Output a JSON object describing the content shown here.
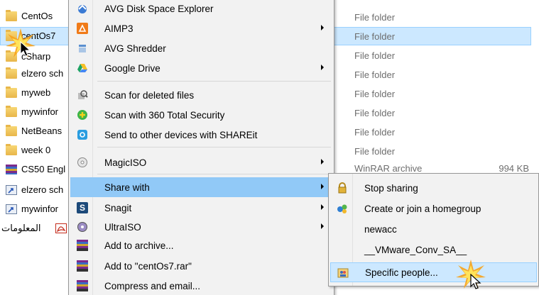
{
  "explorer": {
    "files": [
      {
        "name": "CentOs",
        "type": "File folder",
        "size": "",
        "icon": "folder-icon"
      },
      {
        "name": "centOs7",
        "type": "File folder",
        "size": "",
        "icon": "folder-icon",
        "selected": true
      },
      {
        "name": "cSharp",
        "type": "File folder",
        "size": "",
        "icon": "folder-icon"
      },
      {
        "name": "elzero sch",
        "type": "File folder",
        "size": "",
        "icon": "folder-icon"
      },
      {
        "name": "myweb",
        "type": "File folder",
        "size": "",
        "icon": "folder-icon"
      },
      {
        "name": "mywinfor",
        "type": "File folder",
        "size": "",
        "icon": "folder-icon"
      },
      {
        "name": "NetBeans",
        "type": "File folder",
        "size": "",
        "icon": "folder-icon"
      },
      {
        "name": "week 0",
        "type": "File folder",
        "size": "",
        "icon": "folder-icon"
      },
      {
        "name": "CS50 Engl",
        "type": "WinRAR archive",
        "size": "994 KB",
        "icon": "winrar-icon"
      },
      {
        "name": "elzero sch",
        "type": "",
        "size": "",
        "icon": "shortcut-icon"
      },
      {
        "name": "mywinfor",
        "type": "",
        "size": "",
        "icon": "shortcut-icon"
      },
      {
        "name": "المعلومات",
        "type": "",
        "size": "",
        "icon": "pdf-icon"
      }
    ]
  },
  "context_menu": {
    "items": [
      {
        "label": "AVG Disk Space Explorer",
        "icon": "avg-disk-icon",
        "submenu": false
      },
      {
        "label": "AIMP3",
        "icon": "aimp-icon",
        "submenu": true
      },
      {
        "label": "AVG Shredder",
        "icon": "shredder-icon",
        "submenu": false
      },
      {
        "label": "Google Drive",
        "icon": "google-drive-icon",
        "submenu": true
      },
      {
        "label": "Scan for deleted files",
        "icon": "scan-deleted-icon",
        "submenu": false
      },
      {
        "label": "Scan with 360 Total Security",
        "icon": "total-security-icon",
        "submenu": false
      },
      {
        "label": "Send to other devices with SHAREit",
        "icon": "shareit-icon",
        "submenu": false
      },
      {
        "label": "MagicISO",
        "icon": "magiciso-icon",
        "submenu": true
      },
      {
        "label": "Share with",
        "icon": "",
        "submenu": true,
        "hover": true
      },
      {
        "label": "Snagit",
        "icon": "snagit-icon",
        "submenu": true
      },
      {
        "label": "UltraISO",
        "icon": "ultraiso-icon",
        "submenu": true
      },
      {
        "label": "Add to archive...",
        "icon": "winrar-icon",
        "submenu": false
      },
      {
        "label": "Add to \"centOs7.rar\"",
        "icon": "winrar-icon",
        "submenu": false
      },
      {
        "label": "Compress and email...",
        "icon": "winrar-icon",
        "submenu": false
      }
    ]
  },
  "share_submenu": {
    "items": [
      {
        "label": "Stop sharing",
        "icon": "lock-icon"
      },
      {
        "label": "Create or join a homegroup",
        "icon": "homegroup-icon"
      },
      {
        "label": "newacc",
        "icon": ""
      },
      {
        "label": "__VMware_Conv_SA__",
        "icon": ""
      },
      {
        "label": "Specific people...",
        "icon": "people-icon",
        "highlighted": true
      }
    ]
  },
  "colors": {
    "selection": "#cce8ff",
    "menu_hover": "#91c9f7",
    "menu_bg": "#f2f2f2",
    "folder": "#f8d775"
  }
}
